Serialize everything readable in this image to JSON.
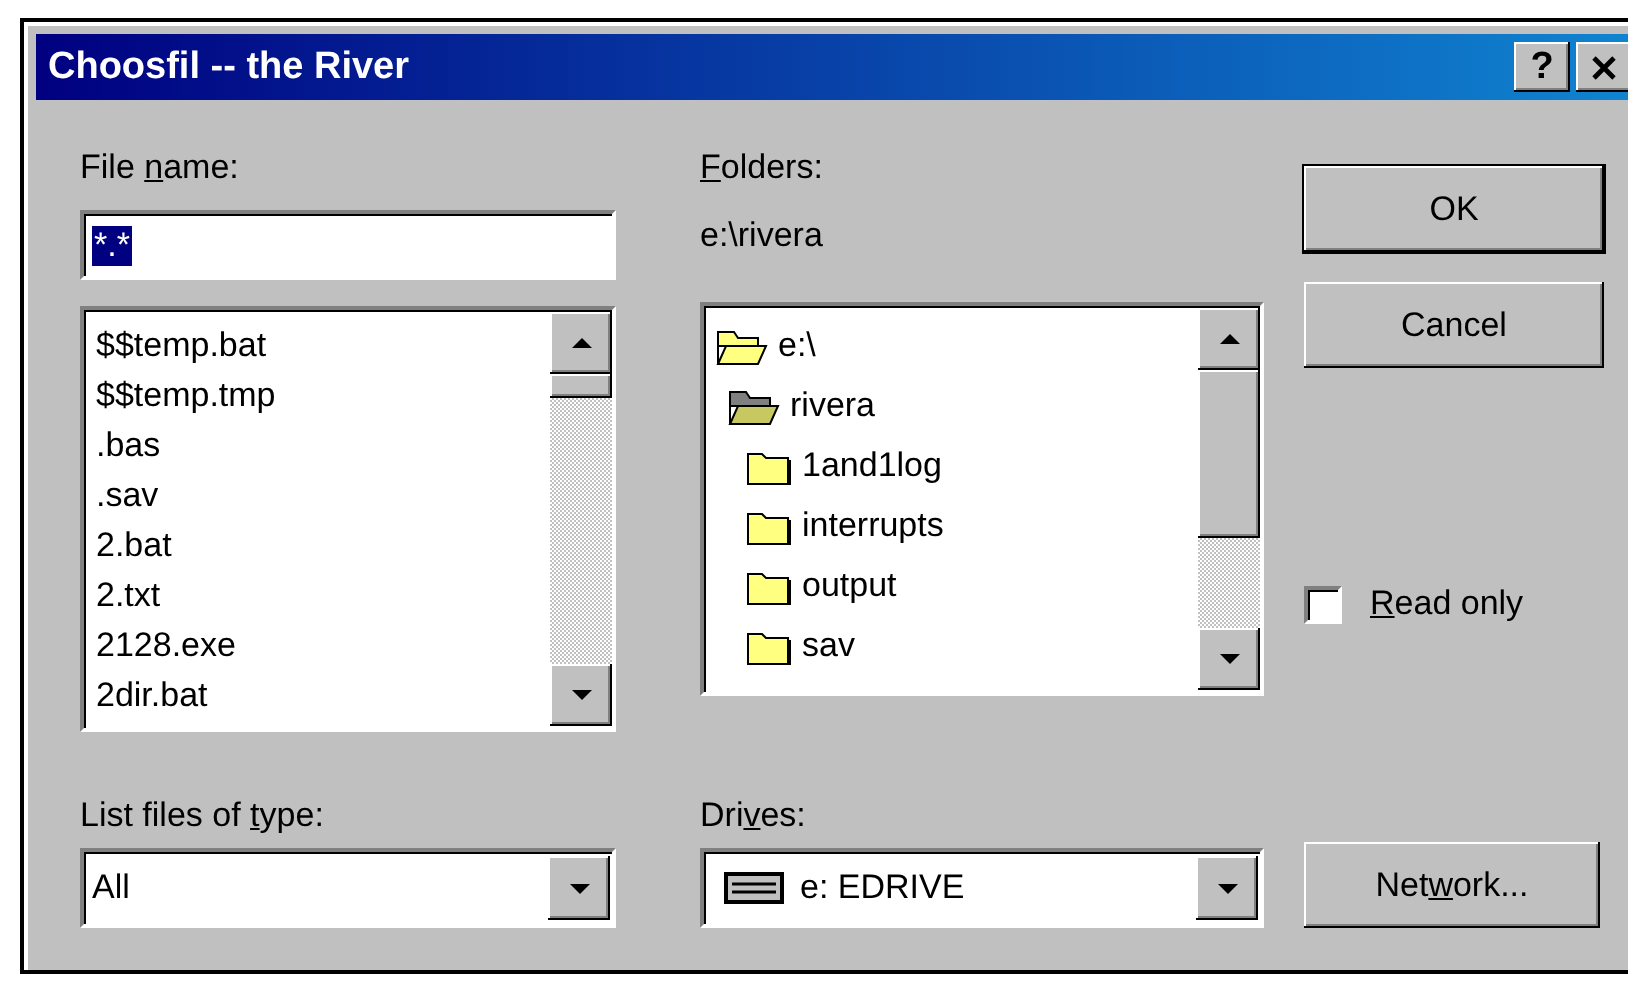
{
  "window": {
    "title": "Choosfil -- the River",
    "help_button": "?"
  },
  "file_name": {
    "label": {
      "pre": "File ",
      "key": "n",
      "post": "ame:"
    },
    "value": "*.*",
    "selected": true
  },
  "files": {
    "items": [
      {
        "name": "$$temp.bat",
        "selected": false
      },
      {
        "name": "$$temp.tmp",
        "selected": false
      },
      {
        "name": ".bas",
        "selected": false
      },
      {
        "name": ".sav",
        "selected": false
      },
      {
        "name": "2.bat",
        "selected": false
      },
      {
        "name": "2.txt",
        "selected": false
      },
      {
        "name": "2128.exe",
        "selected": false
      },
      {
        "name": "2dir.bat",
        "selected": false
      }
    ]
  },
  "file_type": {
    "label": {
      "pre": "List files of ",
      "key": "t",
      "post": "ype:"
    },
    "value": "All"
  },
  "folders": {
    "label": {
      "key": "F",
      "post": "olders:"
    },
    "path": "e:\\rivera",
    "tree": [
      {
        "name": "e:\\",
        "expanded": true,
        "children": [
          {
            "name": "rivera",
            "expanded": true,
            "current": true,
            "children": [
              {
                "name": "1and1log",
                "expanded": false
              },
              {
                "name": "interrupts",
                "expanded": false
              },
              {
                "name": "output",
                "expanded": false
              },
              {
                "name": "sav",
                "expanded": false
              }
            ]
          }
        ]
      }
    ]
  },
  "drives": {
    "label": {
      "pre": "Dri",
      "key": "v",
      "post": "es:"
    },
    "value": "e: EDRIVE"
  },
  "buttons": [
    {
      "label": {
        "post": "OK"
      },
      "kind": "default"
    },
    {
      "label": {
        "post": "Cancel"
      },
      "kind": "normal"
    }
  ],
  "read_only": {
    "label": {
      "key": "R",
      "post": "ead only"
    },
    "checked": false
  },
  "network_button": {
    "label": {
      "pre": "Net",
      "key": "w",
      "post": "ork..."
    }
  }
}
